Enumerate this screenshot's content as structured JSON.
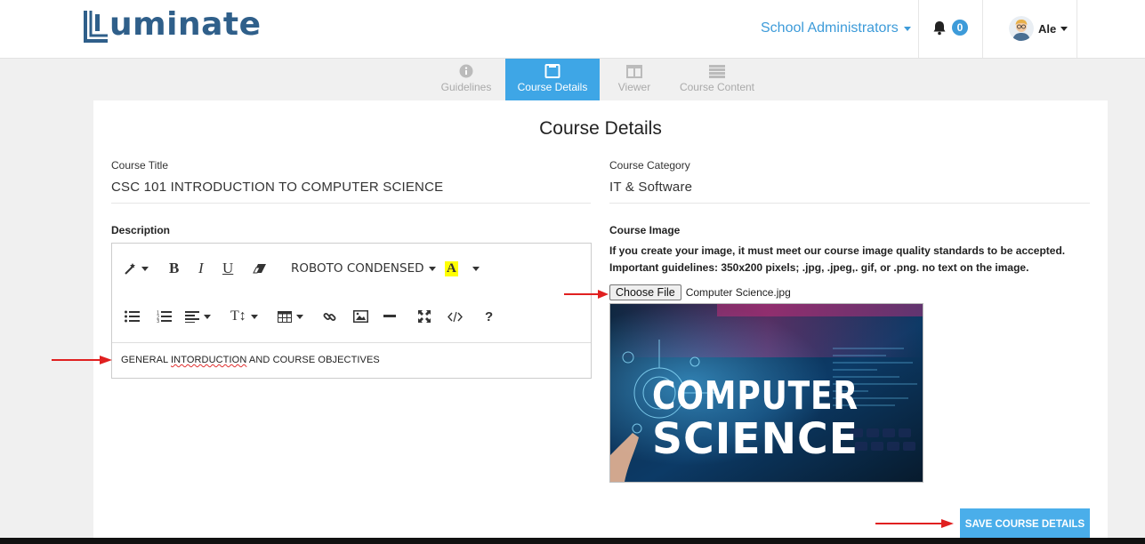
{
  "app": {
    "logo_text": "uminate"
  },
  "navbar": {
    "role_label": "School Administrators",
    "notification_count": "0",
    "user_name": "Ale"
  },
  "tabs": [
    {
      "label": "Guidelines",
      "icon": "info-icon",
      "active": false
    },
    {
      "label": "Course Details",
      "icon": "clipboard-icon",
      "active": true
    },
    {
      "label": "Viewer",
      "icon": "columns-icon",
      "active": false
    },
    {
      "label": "Course Content",
      "icon": "list-icon",
      "active": false
    }
  ],
  "page": {
    "title": "Course Details",
    "course_title_label": "Course Title",
    "course_title_value": "CSC 101 INTRODUCTION TO COMPUTER SCIENCE",
    "course_category_label": "Course Category",
    "course_category_value": "IT & Software",
    "description_label": "Description",
    "course_image_label": "Course Image"
  },
  "editor": {
    "font_name": "ROBOTO CONDENSED",
    "content_before": "GENERAL ",
    "content_misspelled": "INTORDUCTION",
    "content_after": " AND COURSE OBJECTIVES"
  },
  "course_image": {
    "guidelines_text": "If you create your image, it must meet our course image quality standards to be accepted. Important guidelines: 350x200 pixels; .jpg, .jpeg,. gif, or .png. no text on the image.",
    "choose_file_label": "Choose File",
    "file_name": "Computer Science.jpg",
    "image_text_line1": "COMPUTER",
    "image_text_line2": "SCIENCE"
  },
  "actions": {
    "save_label": "SAVE COURSE DETAILS"
  },
  "colors": {
    "accent": "#3ea6e6",
    "brand": "#2f5f8a",
    "annotation_arrow": "#e02020"
  }
}
